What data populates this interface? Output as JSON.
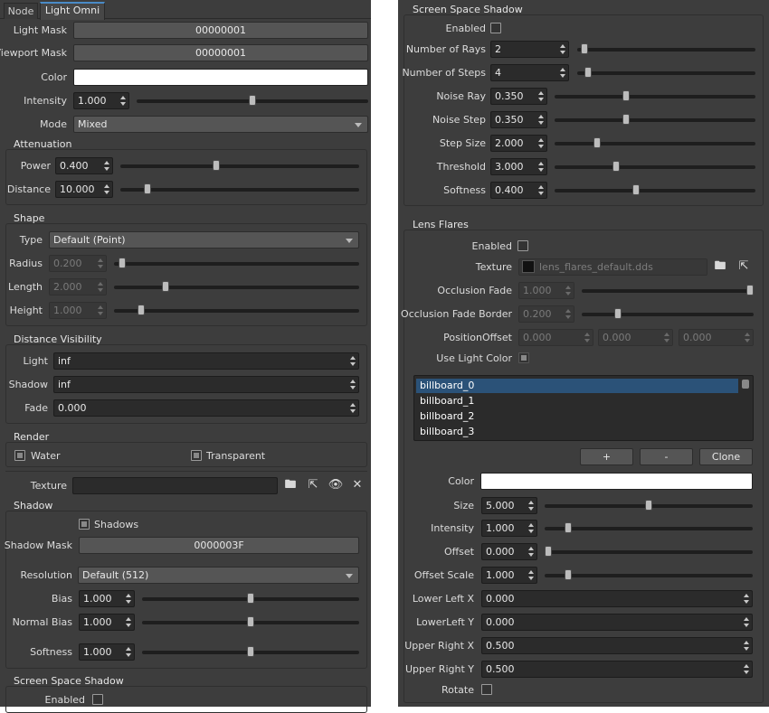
{
  "left": {
    "tabs": [
      {
        "label": "Node"
      },
      {
        "label": "Light Omni"
      }
    ],
    "light_mask": {
      "label": "Light Mask",
      "value": "00000001"
    },
    "viewport_mask": {
      "label": "Viewport Mask",
      "value": "00000001"
    },
    "color": {
      "label": "Color",
      "value": "#ffffff"
    },
    "intensity": {
      "label": "Intensity",
      "value": "1.000",
      "slider": 0.5
    },
    "mode": {
      "label": "Mode",
      "value": "Mixed"
    },
    "attenuation": {
      "title": "Attenuation",
      "power": {
        "label": "Power",
        "value": "0.400",
        "slider": 0.4
      },
      "distance": {
        "label": "Distance",
        "value": "10.000",
        "slider": 0.1
      }
    },
    "shape": {
      "title": "Shape",
      "type": {
        "label": "Type",
        "value": "Default (Point)"
      },
      "radius": {
        "label": "Radius",
        "value": "0.200",
        "slider": 0.02
      },
      "length": {
        "label": "Length",
        "value": "2.000",
        "slider": 0.2
      },
      "height": {
        "label": "Height",
        "value": "1.000",
        "slider": 0.1
      }
    },
    "distance_visibility": {
      "title": "Distance Visibility",
      "light": {
        "label": "Light",
        "value": "inf"
      },
      "shadow": {
        "label": "Shadow",
        "value": "inf"
      },
      "fade": {
        "label": "Fade",
        "value": "0.000"
      }
    },
    "render": {
      "title": "Render",
      "water": {
        "label": "Water",
        "checked": true
      },
      "transparent": {
        "label": "Transparent",
        "checked": true
      }
    },
    "texture": {
      "label": "Texture"
    },
    "shadow": {
      "title": "Shadow",
      "shadows": {
        "label": "Shadows",
        "checked": true
      },
      "shadow_mask": {
        "label": "Shadow Mask",
        "value": "0000003F"
      },
      "resolution": {
        "label": "Resolution",
        "value": "Default (512)"
      },
      "bias": {
        "label": "Bias",
        "value": "1.000",
        "slider": 0.5
      },
      "normal_bias": {
        "label": "Normal Bias",
        "value": "1.000",
        "slider": 0.5
      },
      "softness": {
        "label": "Softness",
        "value": "1.000",
        "slider": 0.5
      }
    },
    "sss": {
      "title": "Screen Space Shadow",
      "enabled": {
        "label": "Enabled",
        "checked": false
      }
    }
  },
  "right": {
    "sss": {
      "title": "Screen Space Shadow",
      "enabled": {
        "label": "Enabled",
        "checked": false
      },
      "rays": {
        "label": "Number of Rays",
        "value": "2",
        "slider": 0.02
      },
      "steps": {
        "label": "Number of Steps",
        "value": "4",
        "slider": 0.04
      },
      "noise_ray": {
        "label": "Noise Ray",
        "value": "0.350",
        "slider": 0.35
      },
      "noise_step": {
        "label": "Noise Step",
        "value": "0.350",
        "slider": 0.35
      },
      "step_size": {
        "label": "Step Size",
        "value": "2.000",
        "slider": 0.2
      },
      "threshold": {
        "label": "Threshold",
        "value": "3.000",
        "slider": 0.3
      },
      "softness": {
        "label": "Softness",
        "value": "0.400",
        "slider": 0.4
      }
    },
    "lens": {
      "title": "Lens Flares",
      "enabled": {
        "label": "Enabled",
        "checked": false
      },
      "texture": {
        "label": "Texture",
        "value": "lens_flares_default.dds"
      },
      "occlusion_fade": {
        "label": "Occlusion Fade",
        "value": "1.000",
        "slider": 1.0
      },
      "occlusion_fade_border": {
        "label": "Occlusion Fade Border",
        "value": "0.200",
        "slider": 0.2
      },
      "position_offset": {
        "label": "PositionOffset",
        "values": [
          "0.000",
          "0.000",
          "0.000"
        ]
      },
      "use_light_color": {
        "label": "Use Light Color",
        "checked": true
      },
      "billboards": [
        "billboard_0",
        "billboard_1",
        "billboard_2",
        "billboard_3"
      ],
      "add_label": "+",
      "remove_label": "-",
      "clone_label": "Clone",
      "color": {
        "label": "Color",
        "value": "#ffffff"
      },
      "size": {
        "label": "Size",
        "value": "5.000",
        "slider": 0.5
      },
      "intensity": {
        "label": "Intensity",
        "value": "1.000",
        "slider": 0.1
      },
      "offset": {
        "label": "Offset",
        "value": "0.000",
        "slider": 0.0
      },
      "offset_scale": {
        "label": "Offset Scale",
        "value": "1.000",
        "slider": 0.1
      },
      "lower_left_x": {
        "label": "Lower Left X",
        "value": "0.000"
      },
      "lower_left_y": {
        "label": "LowerLeft Y",
        "value": "0.000"
      },
      "upper_right_x": {
        "label": "Upper Right X",
        "value": "0.500"
      },
      "upper_right_y": {
        "label": "Upper Right Y",
        "value": "0.500"
      },
      "rotate": {
        "label": "Rotate",
        "checked": false
      }
    }
  },
  "colors": {
    "panel": "#3d3d3d",
    "selection": "#2b5278",
    "field": "#2b2b2b",
    "button": "#555555"
  }
}
